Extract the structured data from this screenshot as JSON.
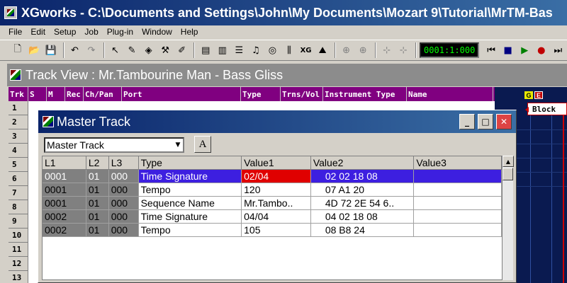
{
  "app": {
    "title": "XGworks - C:\\Documents and Settings\\John\\My Documents\\Mozart 9\\Tutorial\\MrTM-Bas"
  },
  "menu": [
    "File",
    "Edit",
    "Setup",
    "Job",
    "Plug-in",
    "Window",
    "Help"
  ],
  "toolbar": {
    "counter": "0001:1:000",
    "icons": [
      "new-file-icon",
      "open-folder-icon",
      "save-icon",
      "undo-icon",
      "redo-icon",
      "pointer-icon",
      "pencil-icon",
      "eraser-icon",
      "tweezers-icon",
      "brush-icon",
      "track-view-icon",
      "piano-roll-icon",
      "event-list-icon",
      "score-icon",
      "drum-icon",
      "mixer-icon",
      "xg-editor-icon",
      "voice-icon",
      "rewind-icon",
      "stop-icon",
      "play-icon",
      "record-icon",
      "fast-forward-icon"
    ],
    "glyphs": {
      "new": "🗋",
      "open": "📂",
      "save": "💾",
      "undo": "↶",
      "redo": "↷",
      "pointer": "↖",
      "pencil": "✎",
      "eraser": "◈",
      "tweezers": "⚒",
      "brush": "✐",
      "track": "▤",
      "piano": "▥",
      "list": "☰",
      "score": "♫",
      "drum": "◎",
      "mixer": "⫼",
      "xg": "XG",
      "voice": "⛰",
      "sync1": "⊕",
      "sync2": "⊕",
      "metro1": "⊹",
      "metro2": "⊹",
      "rewind": "⏮",
      "stop": "■",
      "play": "▶",
      "record": "●",
      "ff": "⏭"
    }
  },
  "track_view": {
    "title": "Track View : Mr.Tambourine Man - Bass Gliss",
    "columns": [
      "Trk",
      "S",
      "M",
      "Rec",
      "Ch/Pan",
      "Port",
      "Type",
      "Trns/Vol",
      "Instrument Type",
      "Name"
    ],
    "row_numbers": [
      "1",
      "2",
      "3",
      "4",
      "5",
      "6",
      "7",
      "8",
      "9",
      "10",
      "11",
      "12",
      "13"
    ],
    "markers": {
      "g": "G",
      "e": "E"
    },
    "block_label": "Block"
  },
  "master_track": {
    "title": "Master Track",
    "selector_value": "Master Track",
    "a_button": "A",
    "columns": [
      "L1",
      "L2",
      "L3",
      "Type",
      "Value1",
      "Value2",
      "Value3"
    ],
    "rows": [
      {
        "l1": "0001",
        "l2": "01",
        "l3": "000",
        "type": "Time Signature",
        "v1": "02/04",
        "v2": "02 02 18 08",
        "v3": ""
      },
      {
        "l1": "0001",
        "l2": "01",
        "l3": "000",
        "type": "Tempo",
        "v1": "120",
        "v2": "07 A1 20",
        "v3": ""
      },
      {
        "l1": "0001",
        "l2": "01",
        "l3": "000",
        "type": "Sequence Name",
        "v1": "Mr.Tambo..",
        "v2": "4D 72 2E 54 6..",
        "v3": ""
      },
      {
        "l1": "0002",
        "l2": "01",
        "l3": "000",
        "type": "Time Signature",
        "v1": "04/04",
        "v2": "04 02 18 08",
        "v3": ""
      },
      {
        "l1": "0002",
        "l2": "01",
        "l3": "000",
        "type": "Tempo",
        "v1": "105",
        "v2": "08 B8 24",
        "v3": ""
      }
    ],
    "selected_row": 0
  },
  "colors": {
    "title_active": "#0a246a",
    "selection": "#3d1fe0",
    "value_highlight": "#e00000",
    "track_header": "#800080"
  }
}
